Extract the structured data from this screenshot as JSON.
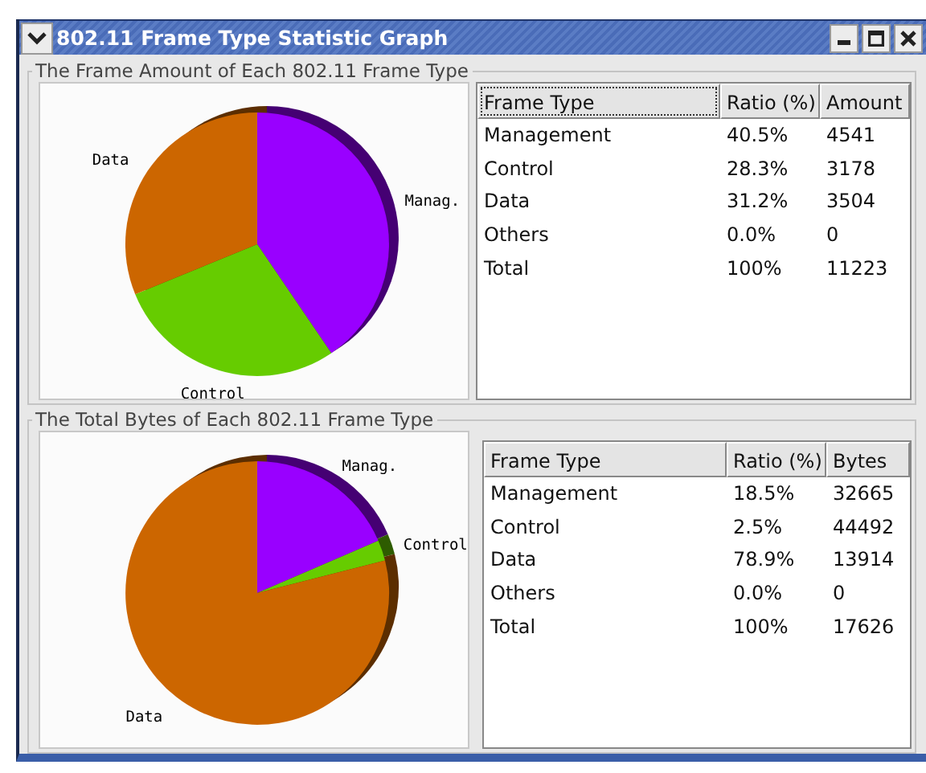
{
  "window": {
    "title": "802.11 Frame Type Statistic Graph"
  },
  "panels": [
    {
      "title": "The Frame Amount of Each 802.11 Frame Type",
      "chart_data": {
        "type": "pie",
        "categories": [
          "Manag.",
          "Control",
          "Data"
        ],
        "values": [
          40.5,
          28.3,
          31.2
        ],
        "colors": [
          "#9900ff",
          "#66cc00",
          "#cc6600"
        ]
      },
      "table": {
        "columns": [
          {
            "label": "Frame Type",
            "focused": true
          },
          {
            "label": "Ratio (%)",
            "focused": false
          },
          {
            "label": "Amount",
            "focused": false
          }
        ],
        "rows": [
          [
            "Management",
            "40.5%",
            "4541"
          ],
          [
            "Control",
            "28.3%",
            "3178"
          ],
          [
            "Data",
            "31.2%",
            "3504"
          ],
          [
            "Others",
            "0.0%",
            "0"
          ],
          [
            "Total",
            "100%",
            "11223"
          ]
        ]
      }
    },
    {
      "title": "The Total Bytes of Each 802.11 Frame Type",
      "chart_data": {
        "type": "pie",
        "categories": [
          "Manag.",
          "Control",
          "Data"
        ],
        "values": [
          18.5,
          2.5,
          78.9
        ],
        "colors": [
          "#9900ff",
          "#66cc00",
          "#cc6600"
        ]
      },
      "table": {
        "columns": [
          {
            "label": "Frame Type",
            "focused": false
          },
          {
            "label": "Ratio (%)",
            "focused": false
          },
          {
            "label": "Bytes",
            "focused": false
          }
        ],
        "rows": [
          [
            "Management",
            "18.5%",
            "32665"
          ],
          [
            "Control",
            "2.5%",
            "44492"
          ],
          [
            "Data",
            "78.9%",
            "13914"
          ],
          [
            "Others",
            "0.0%",
            "0"
          ],
          [
            "Total",
            "100%",
            "17626"
          ]
        ]
      }
    }
  ]
}
